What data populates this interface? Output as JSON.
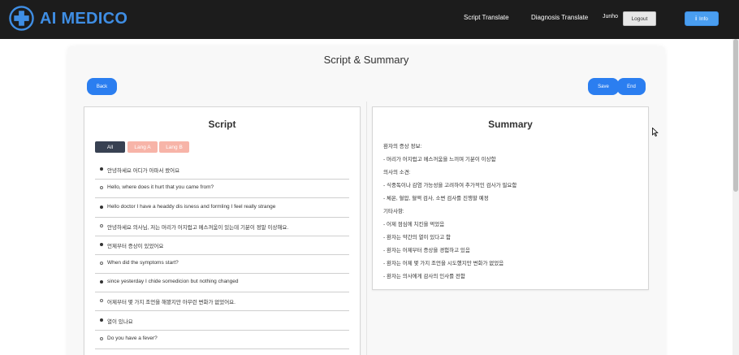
{
  "header": {
    "brand": "AI MEDICO",
    "nav": {
      "script_translate": "Script Translate",
      "diagnosis_translate": "Diagnosis Translate"
    },
    "user": "Junho",
    "logout_label": "Logout",
    "info_label": "Info",
    "info_glyph": "i"
  },
  "page": {
    "title": "Script & Summary",
    "back_label": "Back",
    "save_label": "Save",
    "end_label": "End"
  },
  "script": {
    "title": "Script",
    "filters": [
      "All",
      "Lang A",
      "Lang B"
    ],
    "rows": [
      "안녕하세요 어디가 아파서 왔어요",
      "Hello, where does it hurt that you came from?",
      "Hello doctor I have a headdy dis isness and formling I feel really strange",
      "안녕하세요 의사님, 저는 머리가 어지럽고 메스꺼움이 있는데 기분이 정말 이상해요.",
      "언제부터 증상이 있었어요",
      "When did the symptoms start?",
      "since yesterday I chide somedicion but nothing changed",
      "어제부터 몇 가지 조언을 해봤지만 아무런 변화가 없었어요.",
      "열이 있나요",
      "Do you have a fever?"
    ]
  },
  "summary": {
    "title": "Summary",
    "lines": [
      "환자의 증상 정보:",
      "- 머리가 어지럽고 메스꺼움을 느끼며 기분이 이상함",
      "의사의 소견:",
      "- 식중독이나 감염 가능성을 고려하여 추가적인 검사가 필요함",
      "- 체온, 혈압, 혈액 검사, 소변 검사를 진행할 예정",
      "기타사항:",
      "- 어제 점심에 치킨을 먹었음",
      "- 환자는 약간의 열이 있다고 함",
      "- 환자는 어제부터 증상을 경험하고 있음",
      "- 환자는 어제 몇 가지 조언을 시도했지만 변화가 없었음",
      "- 환자는 의사에게 감사의 인사를 전함"
    ]
  },
  "colors": {
    "accent": "#2b7ef0",
    "brand": "#3f8ee4",
    "header_bg": "#1c1c1c",
    "filter_active": "#384152",
    "filter_inactive": "#f7b4a8"
  },
  "icons": {
    "logo": "medical-cross-icon",
    "info": "info-icon",
    "cursor": "mouse-cursor-icon"
  }
}
